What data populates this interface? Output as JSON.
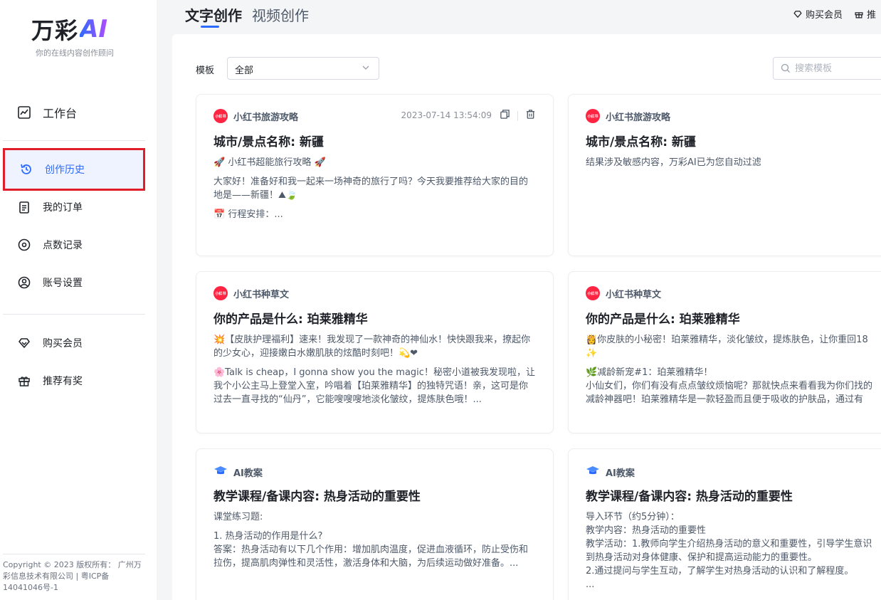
{
  "brand": {
    "name": "万彩",
    "ai": "AI",
    "tagline": "你的在线内容创作顾问"
  },
  "sidebar": {
    "items": [
      {
        "label": "工作台",
        "icon": "chart-line-icon"
      },
      {
        "label": "创作历史",
        "icon": "history-icon",
        "active": true
      },
      {
        "label": "我的订单",
        "icon": "clipboard-icon"
      },
      {
        "label": "点数记录",
        "icon": "record-icon"
      },
      {
        "label": "账号设置",
        "icon": "user-circle-icon"
      },
      {
        "label": "购买会员",
        "icon": "diamond-icon"
      },
      {
        "label": "推荐有奖",
        "icon": "gift-icon"
      }
    ],
    "copyright": "Copyright © 2023 版权所有： 广州万彩信息技术有限公司 | 粤ICP备14041046号-1"
  },
  "header": {
    "tabs": [
      {
        "label": "文字创作",
        "active": true
      },
      {
        "label": "视频创作"
      }
    ],
    "actions": [
      {
        "label": "购买会员",
        "icon": "diamond-icon"
      },
      {
        "label": "推",
        "icon": "gift-icon"
      }
    ]
  },
  "filter": {
    "label": "模板",
    "selected": "全部",
    "search_placeholder": "搜索模板"
  },
  "cards": [
    {
      "category": "小红书旅游攻略",
      "badge": "小红书",
      "time": "2023-07-14 13:54:09",
      "title": "城市/景点名称: 新疆",
      "lines": [
        "🚀 小红书超能旅行攻略 🚀",
        "大家好！准备好和我一起来一场神奇的旅行了吗？今天我要推荐给大家的目的地是——新疆！⛰🍃",
        "📅 行程安排：..."
      ]
    },
    {
      "category": "小红书旅游攻略",
      "badge": "小红书",
      "title": "城市/景点名称: 新疆",
      "lines": [
        "结果涉及敏感内容，万彩AI已为您自动过滤"
      ]
    },
    {
      "category": "小红书种草文",
      "badge": "小红书",
      "title": "你的产品是什么: 珀莱雅精华",
      "lines": [
        "💥【皮肤护理福利】速来！我发现了一款神奇的神仙水！快快跟我来，撩起你的少女心，迎接嫩白水嫩肌肤的炫酷时刻吧！💫❤",
        "🌸Talk is cheap，I gonna show you the magic！秘密小道被我发现啦，让我个小公主马上登堂入室，吟唱着【珀莱雅精华】的独特咒语！亲，这可是你过去一直寻找的“仙丹”，它能嗖嗖嗖地淡化皱纹，提炼肤色哦！..."
      ]
    },
    {
      "category": "小红书种草文",
      "badge": "小红书",
      "title": "你的产品是什么: 珀莱雅精华",
      "lines": [
        "👸你皮肤的小秘密！珀莱雅精华，淡化皱纹，提炼肤色，让你重回18 ✨",
        "🌿减龄新宠#1：珀莱雅精华！",
        "小仙女们，你们有没有点点皱纹烦恼呢？那就快点来看看我为你们找的减龄神器吧！珀莱雅精华是一款轻盈而且便于吸收的护肤品，通过有"
      ]
    },
    {
      "category": "AI教案",
      "badge": "",
      "title": "教学课程/备课内容: 热身活动的重要性",
      "lines": [
        "课堂练习题:",
        "1. 热身活动的作用是什么?",
        "答案：热身活动有以下几个作用：增加肌肉温度，促进血液循环，防止受伤和拉伤，提高肌肉弹性和灵活性，激活身体和大脑，为后续运动做好准备。..."
      ]
    },
    {
      "category": "AI教案",
      "badge": "",
      "title": "教学课程/备课内容: 热身活动的重要性",
      "lines": [
        "导入环节（约5分钟）：",
        "教学内容：热身活动的重要性",
        "教学活动：1.教师向学生介绍热身活动的意义和重要性，引导学生意识到热身活动对身体健康、保护和提高运动能力的重要性。",
        "2.通过提问与学生互动，了解学生对热身活动的认识和了解程度。",
        "..."
      ]
    }
  ],
  "colors": {
    "accent": "#2d6bff",
    "xhs_red": "#ff2442",
    "active_border": "#e11d2a"
  }
}
